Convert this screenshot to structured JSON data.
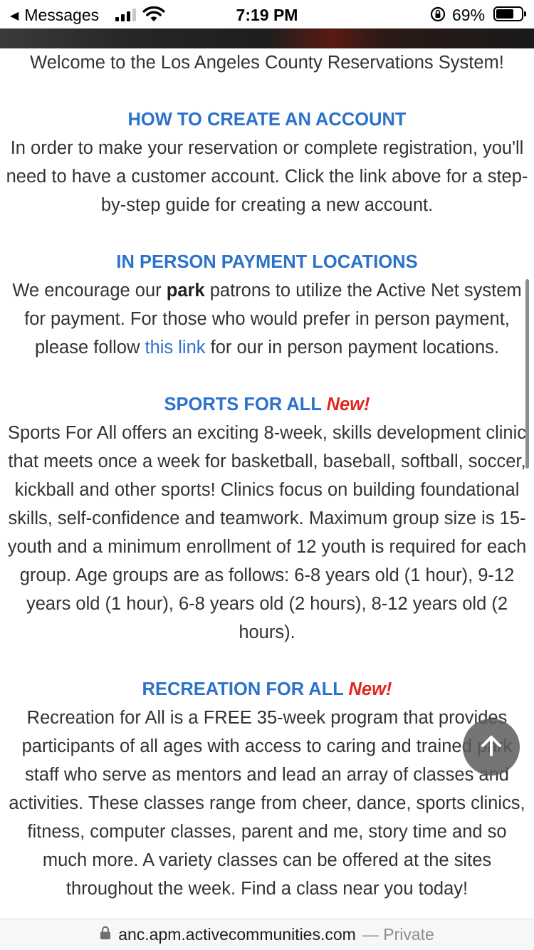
{
  "status_bar": {
    "back_label": "Messages",
    "time": "7:19 PM",
    "battery_percent": "69%",
    "battery_level": 0.69,
    "icons": [
      "back-arrow-icon",
      "cellular-signal-icon",
      "wifi-icon",
      "orientation-lock-icon",
      "battery-icon"
    ]
  },
  "content": {
    "welcome": "Welcome to the Los Angeles County Reservations System!",
    "sections": [
      {
        "heading": "HOW TO CREATE AN ACCOUNT",
        "body": "In order to make your reservation or complete registration, you'll need to have a customer account. Click the link above for a step-by-step guide for creating a new account."
      },
      {
        "heading": "IN PERSON PAYMENT LOCATIONS",
        "body_part1": "We encourage our ",
        "body_bold": "park",
        "body_part2": " patrons to utilize the Active Net system for payment. For those who would prefer in person payment, please follow ",
        "link_text": "this link",
        "body_part3": " for our in person payment locations."
      },
      {
        "heading": "SPORTS FOR ALL",
        "tag": "New!",
        "body": "Sports For All offers an exciting 8-week, skills development clinic that meets once a week for basketball, baseball, softball, soccer, kickball and other sports! Clinics focus on building foundational skills, self-confidence and teamwork. Maximum group size is 15-youth and a minimum enrollment of 12 youth is required for each group. Age groups are as follows: 6-8 years old (1 hour), 9-12 years old (1 hour), 6-8 years old (2 hours), 8-12 years old (2 hours)."
      },
      {
        "heading": "RECREATION FOR ALL",
        "tag": "New!",
        "body": "Recreation for All is a FREE 35-week program that provides participants of all ages with access to caring and trained park staff who serve as mentors and lead an array of classes and activities. These classes range from cheer, dance, sports clinics, fitness, computer classes, parent and me, story time and so much more. A variety classes can be offered at the sites throughout the week. Find a class near you today!"
      }
    ]
  },
  "fab": {
    "icon": "arrow-up-icon"
  },
  "url_bar": {
    "domain": "anc.apm.activecommunities.com",
    "suffix": "— Private",
    "icon": "lock-icon"
  },
  "colors": {
    "heading": "#2c72c9",
    "new_tag": "#e0261f",
    "text": "#333333",
    "link": "#2c72c9"
  }
}
